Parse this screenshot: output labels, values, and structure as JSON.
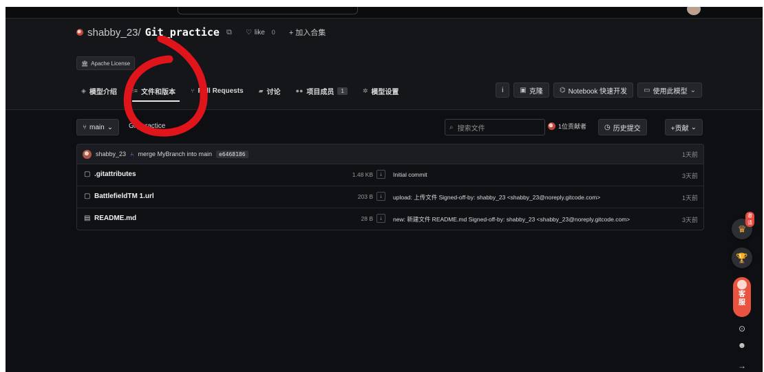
{
  "repo": {
    "owner": "shabby_23/",
    "name": "Git_practice",
    "like_label": "like",
    "like_count": "0",
    "collect_label": "+ 加入合集",
    "license": "Apache License"
  },
  "tabs": [
    {
      "label": "模型介绍"
    },
    {
      "label": "文件和版本"
    },
    {
      "label": "Pull Requests"
    },
    {
      "label": "讨论"
    },
    {
      "label": "项目成员",
      "badge": "1"
    },
    {
      "label": "模型设置"
    }
  ],
  "actions": {
    "info": "i",
    "clone": "克隆",
    "notebook": "Notebook 快速开发",
    "use_model": "使用此模型"
  },
  "branch": {
    "name": "main",
    "repo_crumb": "Git_practice",
    "search_placeholder": "搜索文件",
    "contributors": "1位贡献者",
    "history": "历史提交",
    "contribute": "+贡献"
  },
  "latest_commit": {
    "author": "shabby_23",
    "message": "merge MyBranch into main",
    "hash": "e6468186",
    "time": "1天前"
  },
  "files": [
    {
      "name": ".gitattributes",
      "size": "1.48 KB",
      "message": "Initial commit",
      "time": "3天前"
    },
    {
      "name": "BattlefieldTM 1.url",
      "size": "203 B",
      "message": "upload: 上传文件 Signed-off-by: shabby_23 <shabby_23@noreply.gitcode.com>",
      "time": "1天前"
    },
    {
      "name": "README.md",
      "size": "28 B",
      "message": "new: 新建文件 README.md Signed-off-by: shabby_23 <shabby_23@noreply.gitcode.com>",
      "time": "3天前"
    }
  ],
  "float": {
    "invite": "邀请",
    "kefu_1": "客",
    "kefu_2": "服"
  },
  "colors": {
    "background": "#0e0f12",
    "header": "#15161a",
    "annotation_red": "#e0141b",
    "kefu": "#e8543f"
  }
}
